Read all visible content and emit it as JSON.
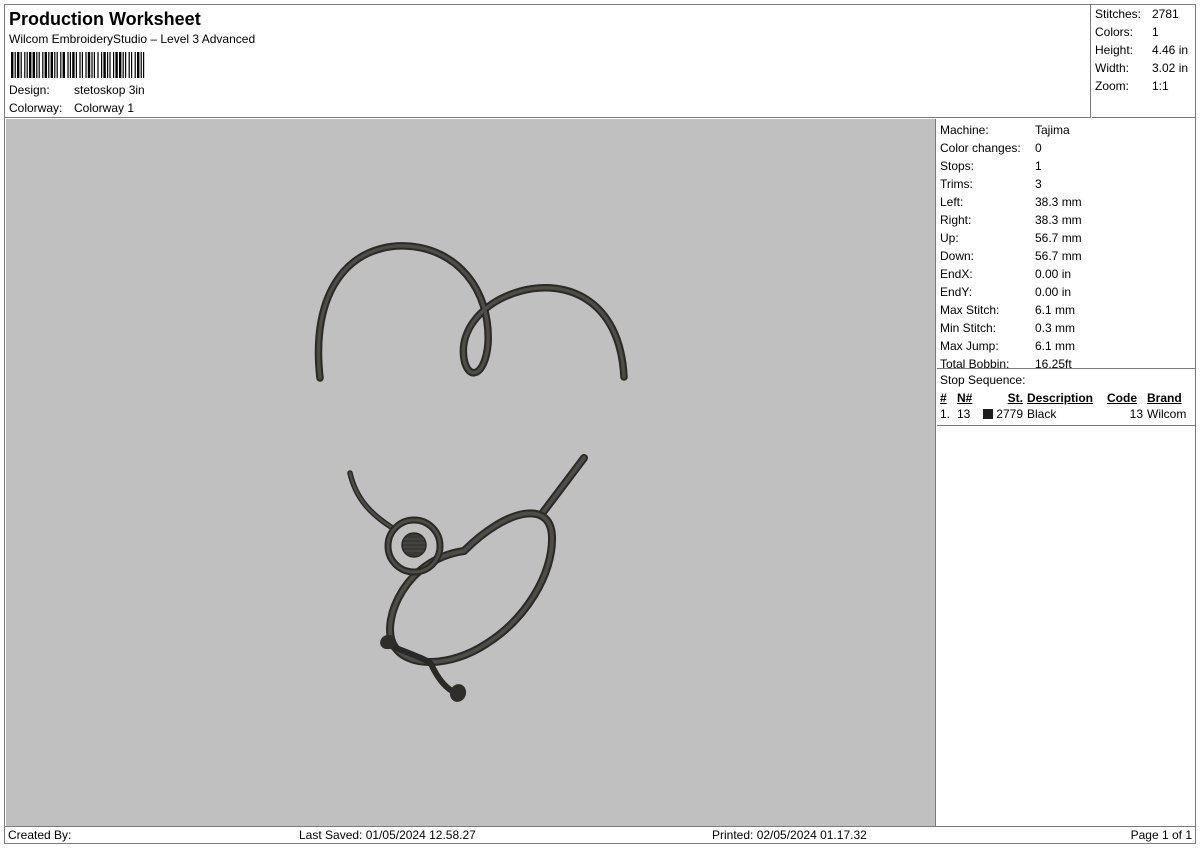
{
  "header": {
    "title": "Production Worksheet",
    "subtitle": "Wilcom EmbroideryStudio – Level 3 Advanced",
    "design_label": "Design:",
    "design_value": "stetoskop 3in",
    "colorway_label": "Colorway:",
    "colorway_value": "Colorway 1"
  },
  "summary": [
    {
      "label": "Stitches:",
      "value": "2781"
    },
    {
      "label": "Colors:",
      "value": "1"
    },
    {
      "label": "Height:",
      "value": "4.46 in"
    },
    {
      "label": "Width:",
      "value": "3.02 in"
    },
    {
      "label": "Zoom:",
      "value": "1:1"
    }
  ],
  "machine": [
    {
      "label": "Machine:",
      "value": "Tajima"
    },
    {
      "label": "Color changes:",
      "value": "0"
    },
    {
      "label": "Stops:",
      "value": "1"
    },
    {
      "label": "Trims:",
      "value": "3"
    },
    {
      "label": "Left:",
      "value": "38.3 mm"
    },
    {
      "label": "Right:",
      "value": "38.3 mm"
    },
    {
      "label": "Up:",
      "value": "56.7 mm"
    },
    {
      "label": "Down:",
      "value": "56.7 mm"
    },
    {
      "label": "EndX:",
      "value": "0.00 in"
    },
    {
      "label": "EndY:",
      "value": "0.00 in"
    },
    {
      "label": "Max Stitch:",
      "value": "6.1 mm"
    },
    {
      "label": "Min Stitch:",
      "value": "0.3 mm"
    },
    {
      "label": "Max Jump:",
      "value": "6.1 mm"
    },
    {
      "label": "Total Bobbin:",
      "value": "16.25ft"
    }
  ],
  "stop_sequence": {
    "heading": "Stop Sequence:",
    "columns": [
      "#",
      "N#",
      "St.",
      "Description",
      "Code",
      "Brand"
    ],
    "rows": [
      {
        "num": "1.",
        "needle": "13",
        "stitches": "2779",
        "description": "Black",
        "code": "13",
        "brand": "Wilcom",
        "color": "#1e1e1e"
      }
    ]
  },
  "footer": {
    "created_by": "Created By:",
    "last_saved": "Last Saved: 01/05/2024 12.58.27",
    "printed": "Printed: 02/05/2024 01.17.32",
    "page": "Page 1 of 1"
  },
  "colors": {
    "thread": "#3b3a35",
    "canvas": "#c0c0c0",
    "border": "#7a7a7a"
  }
}
